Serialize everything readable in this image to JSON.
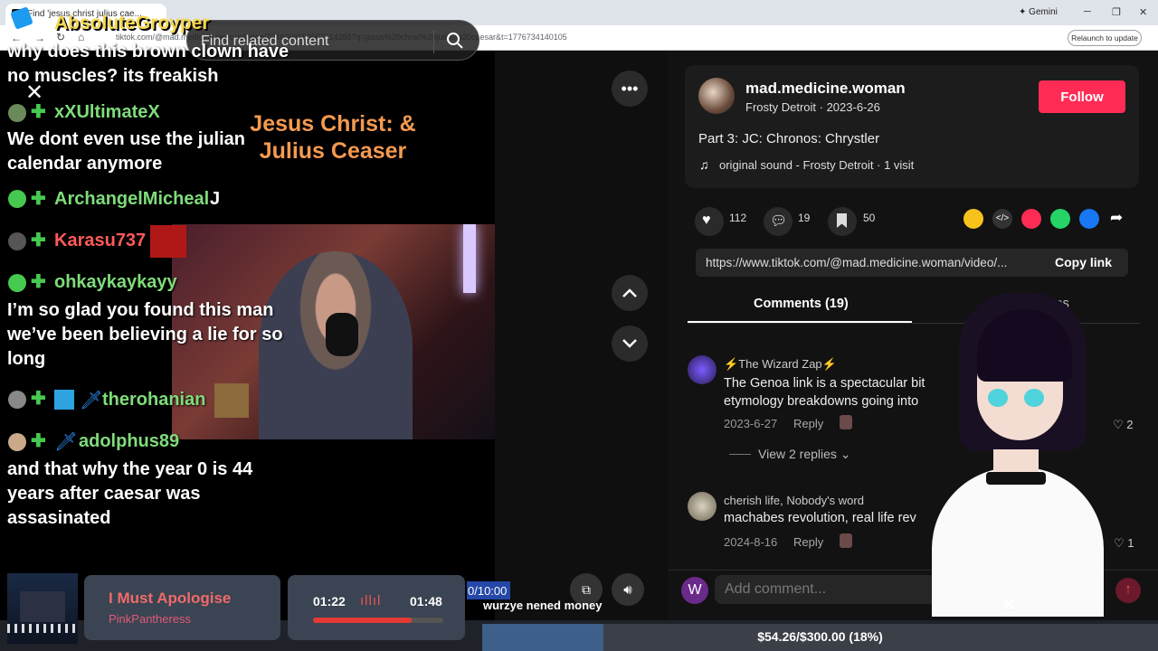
{
  "browser": {
    "tab_title": "Find 'jesus christ julius cae...",
    "url": "tiktok.com/@mad.medicine.woman/video/7249009199907114286?q=jesus%20christ%20julius%20caesar&t=1776734140105",
    "gemini_label": "Gemini",
    "relaunch_label": "Relaunch to update"
  },
  "stream_overlay": {
    "streamer_name": "AbsoluteGroyper",
    "chat": [
      {
        "user": "",
        "message": "why does this brown clown have no muscles? its freakish"
      },
      {
        "user": "xXUltimateX",
        "user_color": "#7fdc7a",
        "message": "We dont even use the julian calendar anymore"
      },
      {
        "user": "ArchangelMicheal",
        "user_color": "#7fdc7a",
        "message": "J"
      },
      {
        "user": "Karasu737",
        "user_color": "#ff5a5a",
        "message": ""
      },
      {
        "user": "ohkaykaykayy",
        "user_color": "#7fdc7a",
        "message": "I’m so glad you found this man we’ve been believing a lie for so long"
      },
      {
        "user": "therohanian",
        "user_color": "#7fdc7a",
        "message": ""
      },
      {
        "user": "adolphus89",
        "user_color": "#7fdc7a",
        "message": "and that why the year 0 is 44 years after caesar was assasinated"
      }
    ],
    "now_playing": {
      "title": "I Must Apologise",
      "artist": "PinkPantheress"
    },
    "player": {
      "elapsed": "01:22",
      "total": "01:48",
      "progress": 0.76
    },
    "counter": "0/10:00",
    "ticker": "wurzye nened money",
    "goal": {
      "text": "$54.26/$300.00 (18%)",
      "fraction": 0.18
    }
  },
  "video": {
    "search_placeholder": "Find related content",
    "title_overlay": "Jesus Christ: & Julius Ceaser"
  },
  "post": {
    "username": "mad.medicine.woman",
    "meta": "Frosty Detroit · 2023-6-26",
    "follow_label": "Follow",
    "caption": "Part 3: JC: Chronos: Chrystler",
    "sound": "original sound - Frosty Detroit · 1 visit",
    "likes": "112",
    "comments": "19",
    "saves": "50",
    "link": "https://www.tiktok.com/@mad.medicine.woman/video/...",
    "copy_label": "Copy link",
    "tab_comments": "Comments (19)",
    "tab_videos": "videos"
  },
  "comments": [
    {
      "author": "⚡The Wizard Zap⚡",
      "text": "The Genoa link is a spectacular bit etymology breakdowns going into",
      "date": "2023-6-27",
      "reply": "Reply",
      "likes": "2",
      "view_replies": "View 2 replies"
    },
    {
      "author": "cherish life, Nobody's word",
      "text": "machabes revolution, real life rev",
      "date": "2024-8-16",
      "reply": "Reply",
      "likes": "1"
    }
  ],
  "comment_input": {
    "placeholder": "Add comment...",
    "user_initial": "W"
  },
  "colors": {
    "follow": "#fe2c55",
    "accent_green": "#46c94f",
    "title_orange": "#f49a50"
  }
}
